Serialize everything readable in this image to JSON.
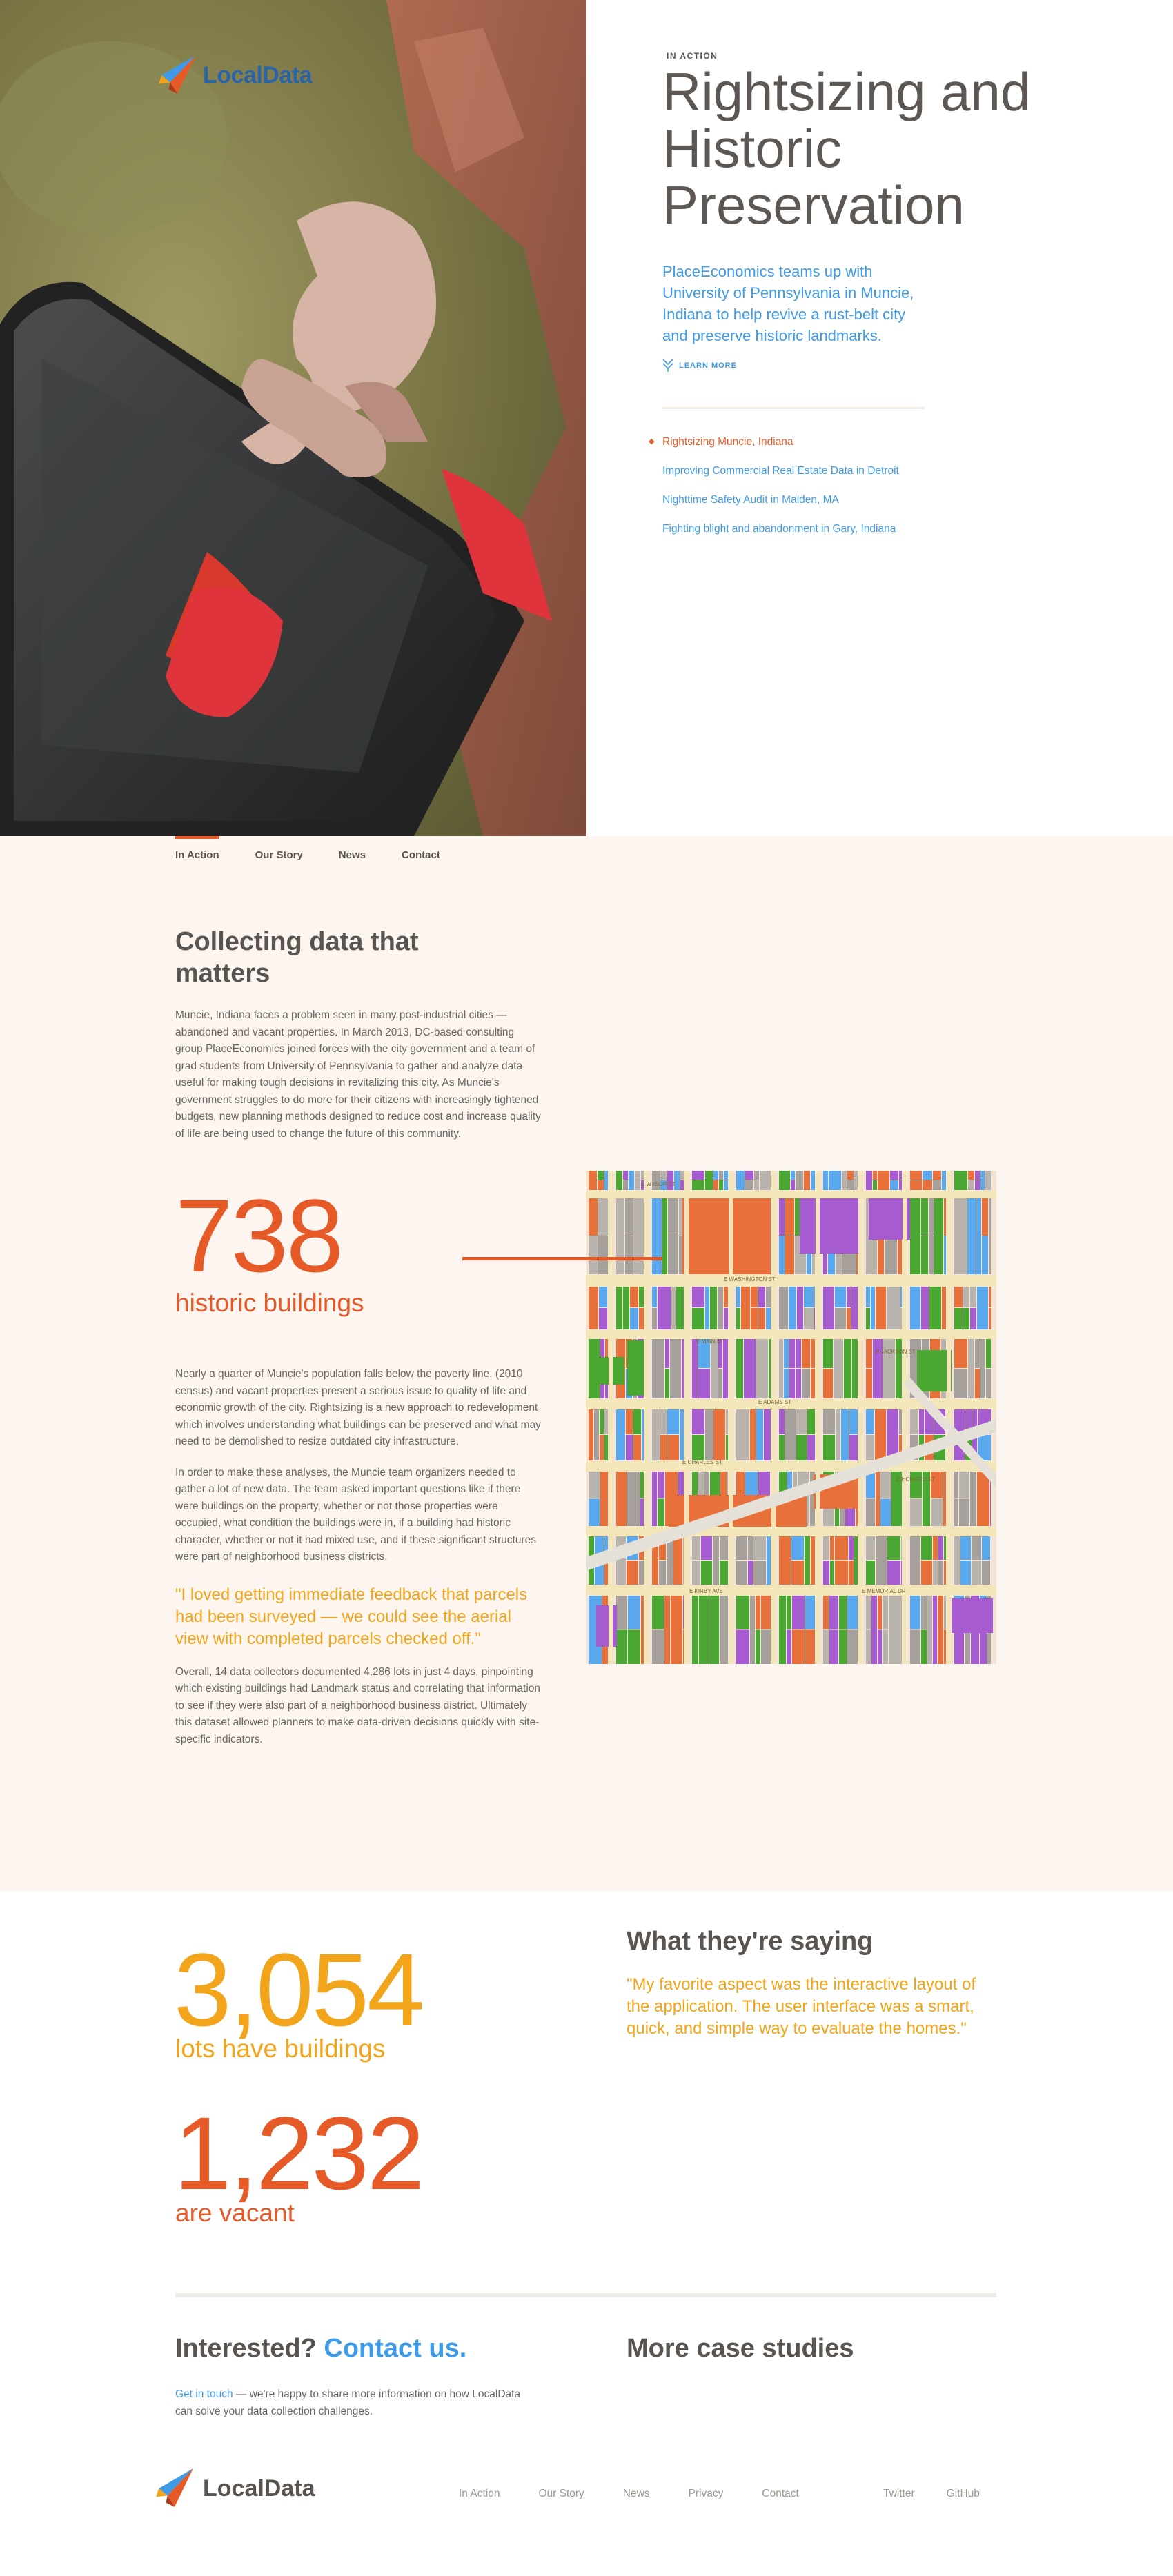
{
  "brand": {
    "name": "LocalData"
  },
  "hero": {
    "eyebrow": "IN ACTION",
    "title": "Rightsizing and Historic Preservation",
    "subtitle": "PlaceEconomics teams up with University of Pennsylvania in Muncie, Indiana to help revive a rust-belt city and preserve historic landmarks.",
    "learn_more": "LEARN MORE",
    "cases": [
      {
        "label": "Rightsizing Muncie, Indiana",
        "active": true
      },
      {
        "label": "Improving Commercial Real Estate Data in Detroit",
        "active": false
      },
      {
        "label": "Nighttime Safety Audit in Malden, MA",
        "active": false
      },
      {
        "label": "Fighting blight and abandonment in Gary, Indiana",
        "active": false
      }
    ]
  },
  "nav": {
    "items": [
      "In Action",
      "Our Story",
      "News",
      "Contact"
    ]
  },
  "collect": {
    "heading": "Collecting data that matters",
    "para1": "Muncie, Indiana faces a problem seen in many post-industrial cities — abandoned and vacant properties. In March 2013, DC-based consulting group PlaceEconomics joined forces with the city government and a team of grad students from University of Pennsylvania to gather and analyze data useful for making tough decisions in revitalizing this city. As Muncie's government struggles to do more for their citizens with increasingly tightened budgets, new planning methods designed to reduce cost and increase quality of life are being used to change the future of this community.",
    "stat_value": "738",
    "stat_label": "historic buildings",
    "para2": "Nearly a quarter of Muncie's population falls below the poverty line, (2010 census) and vacant properties present a serious issue to quality of life and economic growth of the city. Rightsizing is a new approach to redevelopment which involves understanding what buildings can be preserved and what may need to be demolished to resize outdated city infrastructure.",
    "para3": "In order to make these analyses, the Muncie team organizers needed to gather a lot of new data. The team asked important questions like if there were buildings on the property, whether or not those properties were occupied, what condition the buildings were in, if a building had historic character, whether or not it had mixed use, and if these significant structures were part of neighborhood business districts.",
    "quote": "\"I loved getting immediate feedback that parcels had been surveyed — we could see the aerial view with completed parcels checked off.\"",
    "para4": "Overall, 14 data collectors documented 4,286 lots in just 4 days, pinpointing which existing buildings had Landmark status and correlating that information to see if they were also part of a neighborhood business district. Ultimately this dataset allowed planners to make data-driven decisions quickly with site-specific indicators."
  },
  "map": {
    "streets": [
      "E WYSOR ST",
      "E WASHINGTON ST",
      "E MAIN ST",
      "E JACKSON ST",
      "E ADAMS ST",
      "E CHARLES ST",
      "E HOWARD ST",
      "E KIRBY AVE",
      "E MEMORIAL DR"
    ],
    "colors": [
      "#e8703a",
      "#a65bd1",
      "#5aa8ee",
      "#4aa832",
      "#a5a09c",
      "#b9b3ae"
    ]
  },
  "stats": {
    "buildings_value": "3,054",
    "buildings_label": "lots have buildings",
    "vacant_value": "1,232",
    "vacant_label": "are vacant",
    "buildings_color": "#f2a51b",
    "vacant_color": "#e65a28"
  },
  "testimonial": {
    "heading": "What they're saying",
    "quote": "\"My favorite aspect was the interactive layout of the application. The user interface was a smart, quick, and simple way to evaluate the homes.\""
  },
  "contact": {
    "heading_a": "Interested?",
    "heading_b": "Contact us.",
    "link": "Get in touch",
    "text": " — we're happy to share more information on how LocalData can solve your data collection challenges.",
    "more_heading": "More case studies"
  },
  "footer": {
    "links": [
      "In Action",
      "Our Story",
      "News",
      "Privacy",
      "Contact"
    ],
    "social": [
      "Twitter",
      "GitHub"
    ]
  }
}
